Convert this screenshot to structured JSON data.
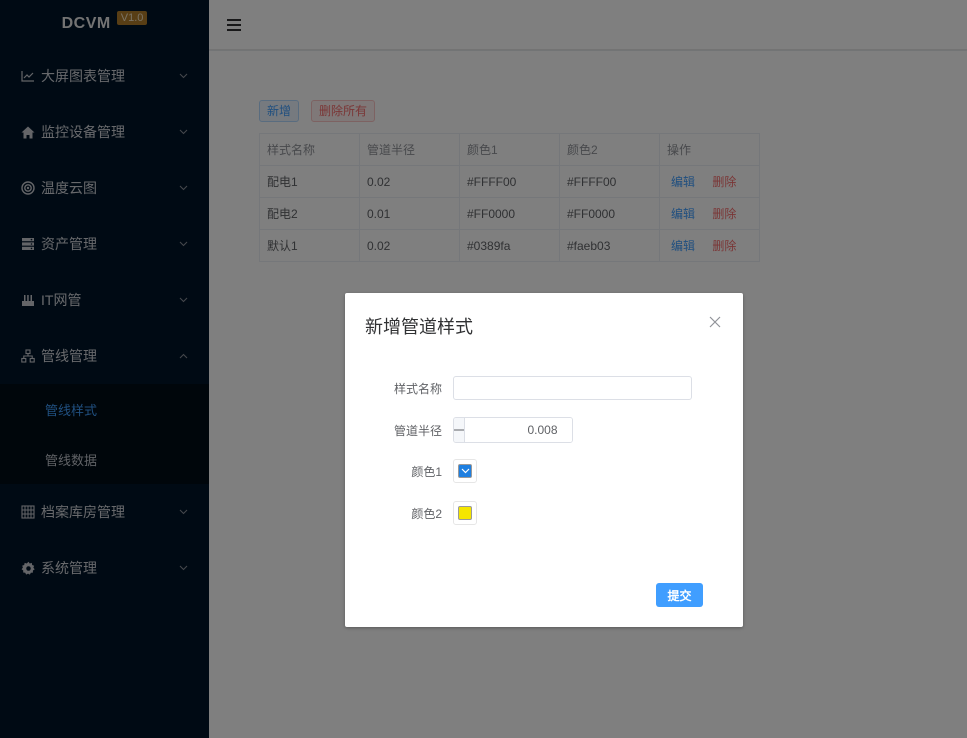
{
  "app": {
    "logo_text": "DCVM",
    "version": "V1.0"
  },
  "sidebar": {
    "items": [
      {
        "label": "大屏图表管理",
        "icon": "line-chart-icon"
      },
      {
        "label": "监控设备管理",
        "icon": "home-icon"
      },
      {
        "label": "温度云图",
        "icon": "target-icon"
      },
      {
        "label": "资产管理",
        "icon": "server-icon"
      },
      {
        "label": "IT网管",
        "icon": "network-device-icon"
      },
      {
        "label": "管线管理",
        "icon": "sitemap-icon",
        "expanded": true,
        "children": [
          {
            "label": "管线样式",
            "active": true
          },
          {
            "label": "管线数据"
          }
        ]
      },
      {
        "label": "档案库房管理",
        "icon": "archive-icon"
      },
      {
        "label": "系统管理",
        "icon": "gear-icon"
      }
    ]
  },
  "toolbar": {
    "add_label": "新增",
    "delete_all_label": "删除所有"
  },
  "table": {
    "columns": [
      "样式名称",
      "管道半径",
      "颜色1",
      "颜色2",
      "操作"
    ],
    "rows": [
      [
        "配电1",
        "0.02",
        "#FFFF00",
        "#FFFF00"
      ],
      [
        "配电2",
        "0.01",
        "#FF0000",
        "#FF0000"
      ],
      [
        "默认1",
        "0.02",
        "#0389fa",
        "#faeb03"
      ]
    ],
    "edit_label": "编辑",
    "delete_label": "删除"
  },
  "dialog": {
    "title": "新增管道样式",
    "fields": {
      "name_label": "样式名称",
      "name_value": "",
      "radius_label": "管道半径",
      "radius_value": "0.008",
      "color1_label": "颜色1",
      "color1_value": "#1e7fe0",
      "color2_label": "颜色2",
      "color2_value": "#f5e600"
    },
    "submit_label": "提交"
  },
  "colors": {
    "primary": "#409eff",
    "danger": "#f56c6c",
    "sidebar_bg": "#001529"
  }
}
